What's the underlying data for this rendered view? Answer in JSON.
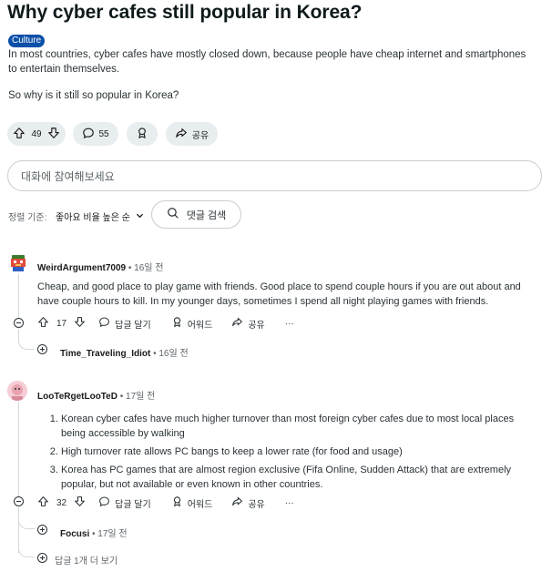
{
  "post": {
    "title": "Why cyber cafes still popular in Korea?",
    "flair": "Culture",
    "paragraph1": "In most countries, cyber cafes have mostly closed down, because people have cheap internet and smartphones to entertain themselves.",
    "paragraph2": "So why is it still so popular in Korea?",
    "votes": "49",
    "comments": "55",
    "share_label": "공유"
  },
  "comment_input": {
    "placeholder": "대화에 참여해보세요"
  },
  "sort": {
    "label": "정렬 기준:",
    "value": "좋아요 비율 높은 순",
    "search_label": "댓글 검색"
  },
  "comments": [
    {
      "username": "WeirdArgument7009",
      "time": "16일 전",
      "text": "Cheap, and good place to play game with friends. Good place to spend couple hours if you are out about and have couple hours to kill. In my younger days, sometimes I spend all night playing games with friends.",
      "votes": "17",
      "reply_label": "답글 달기",
      "award_label": "어워드",
      "share_label": "공유",
      "more_label": "···",
      "reply_user": "Time_Traveling_Idiot",
      "reply_time": "16일 전"
    },
    {
      "username": "LooTeRgetLooTeD",
      "time": "17일 전",
      "points": [
        "Korean cyber cafes have much higher turnover than most foreign cyber cafes due to most local places being accessible by walking",
        "High turnover rate allows PC bangs to keep a lower rate (for food and usage)",
        "Korea has PC games that are almost region exclusive (Fifa Online, Sudden Attack) that are extremely popular, but not available or even known in other countries."
      ],
      "votes": "32",
      "reply_label": "답글 달기",
      "award_label": "어워드",
      "share_label": "공유",
      "more_label": "···",
      "reply_user": "Focusi",
      "reply_time": "17일 전",
      "more_replies": "답글 1개 더 보기"
    }
  ]
}
